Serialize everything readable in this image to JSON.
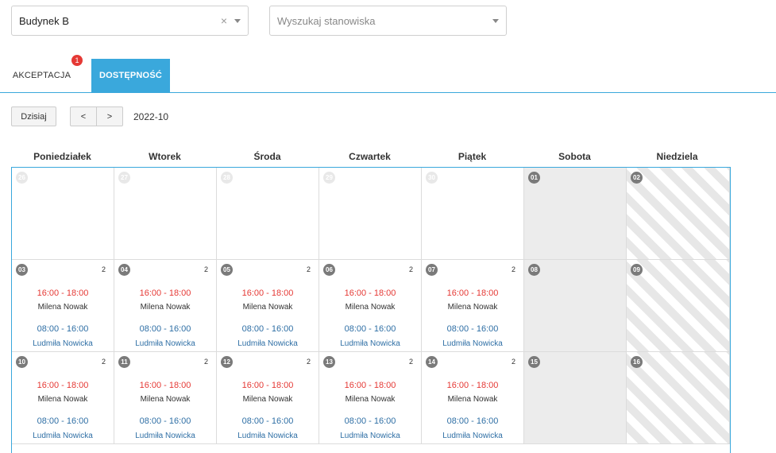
{
  "filters": {
    "building_value": "Budynek B",
    "clear_symbol": "×",
    "search_placeholder": "Wyszukaj stanowiska"
  },
  "tabs": [
    {
      "label": "AKCEPTACJA",
      "badge": "1"
    },
    {
      "label": "DOSTĘPNOŚĆ",
      "active": true
    }
  ],
  "toolbar": {
    "today_label": "Dzisiaj",
    "prev_label": "<",
    "next_label": ">",
    "month": "2022-10"
  },
  "calendar": {
    "weekdays": [
      "Poniedziałek",
      "Wtorek",
      "Środa",
      "Czwartek",
      "Piątek",
      "Sobota",
      "Niedziela"
    ],
    "weeks": [
      {
        "days": [
          {
            "num": "26",
            "faded": true
          },
          {
            "num": "27",
            "faded": true
          },
          {
            "num": "28",
            "faded": true
          },
          {
            "num": "29",
            "faded": true
          },
          {
            "num": "30",
            "faded": true
          },
          {
            "num": "01"
          },
          {
            "num": "02"
          }
        ]
      },
      {
        "days": [
          {
            "num": "03",
            "count": "2",
            "slot1": "16:00 - 18:00",
            "person1": "Milena Nowak",
            "slot2": "08:00 - 16:00",
            "person2": "Ludmiła Nowicka"
          },
          {
            "num": "04",
            "count": "2",
            "slot1": "16:00 - 18:00",
            "person1": "Milena Nowak",
            "slot2": "08:00 - 16:00",
            "person2": "Ludmiła Nowicka"
          },
          {
            "num": "05",
            "count": "2",
            "slot1": "16:00 - 18:00",
            "person1": "Milena Nowak",
            "slot2": "08:00 - 16:00",
            "person2": "Ludmiła Nowicka"
          },
          {
            "num": "06",
            "count": "2",
            "slot1": "16:00 - 18:00",
            "person1": "Milena Nowak",
            "slot2": "08:00 - 16:00",
            "person2": "Ludmiła Nowicka"
          },
          {
            "num": "07",
            "count": "2",
            "slot1": "16:00 - 18:00",
            "person1": "Milena Nowak",
            "slot2": "08:00 - 16:00",
            "person2": "Ludmiła Nowicka"
          },
          {
            "num": "08"
          },
          {
            "num": "09"
          }
        ]
      },
      {
        "days": [
          {
            "num": "10",
            "count": "2",
            "slot1": "16:00 - 18:00",
            "person1": "Milena Nowak",
            "slot2": "08:00 - 16:00",
            "person2": "Ludmiła Nowicka"
          },
          {
            "num": "11",
            "count": "2",
            "slot1": "16:00 - 18:00",
            "person1": "Milena Nowak",
            "slot2": "08:00 - 16:00",
            "person2": "Ludmiła Nowicka"
          },
          {
            "num": "12",
            "count": "2",
            "slot1": "16:00 - 18:00",
            "person1": "Milena Nowak",
            "slot2": "08:00 - 16:00",
            "person2": "Ludmiła Nowicka"
          },
          {
            "num": "13",
            "count": "2",
            "slot1": "16:00 - 18:00",
            "person1": "Milena Nowak",
            "slot2": "08:00 - 16:00",
            "person2": "Ludmiła Nowicka"
          },
          {
            "num": "14",
            "count": "2",
            "slot1": "16:00 - 18:00",
            "person1": "Milena Nowak",
            "slot2": "08:00 - 16:00",
            "person2": "Ludmiła Nowicka"
          },
          {
            "num": "15"
          },
          {
            "num": "16"
          }
        ]
      }
    ]
  },
  "colors": {
    "accent": "#3aa8dc",
    "badge": "#e53935",
    "slot_red": "#e53935",
    "slot_blue": "#2f6fa5",
    "weekend_gray": "#ececec"
  }
}
